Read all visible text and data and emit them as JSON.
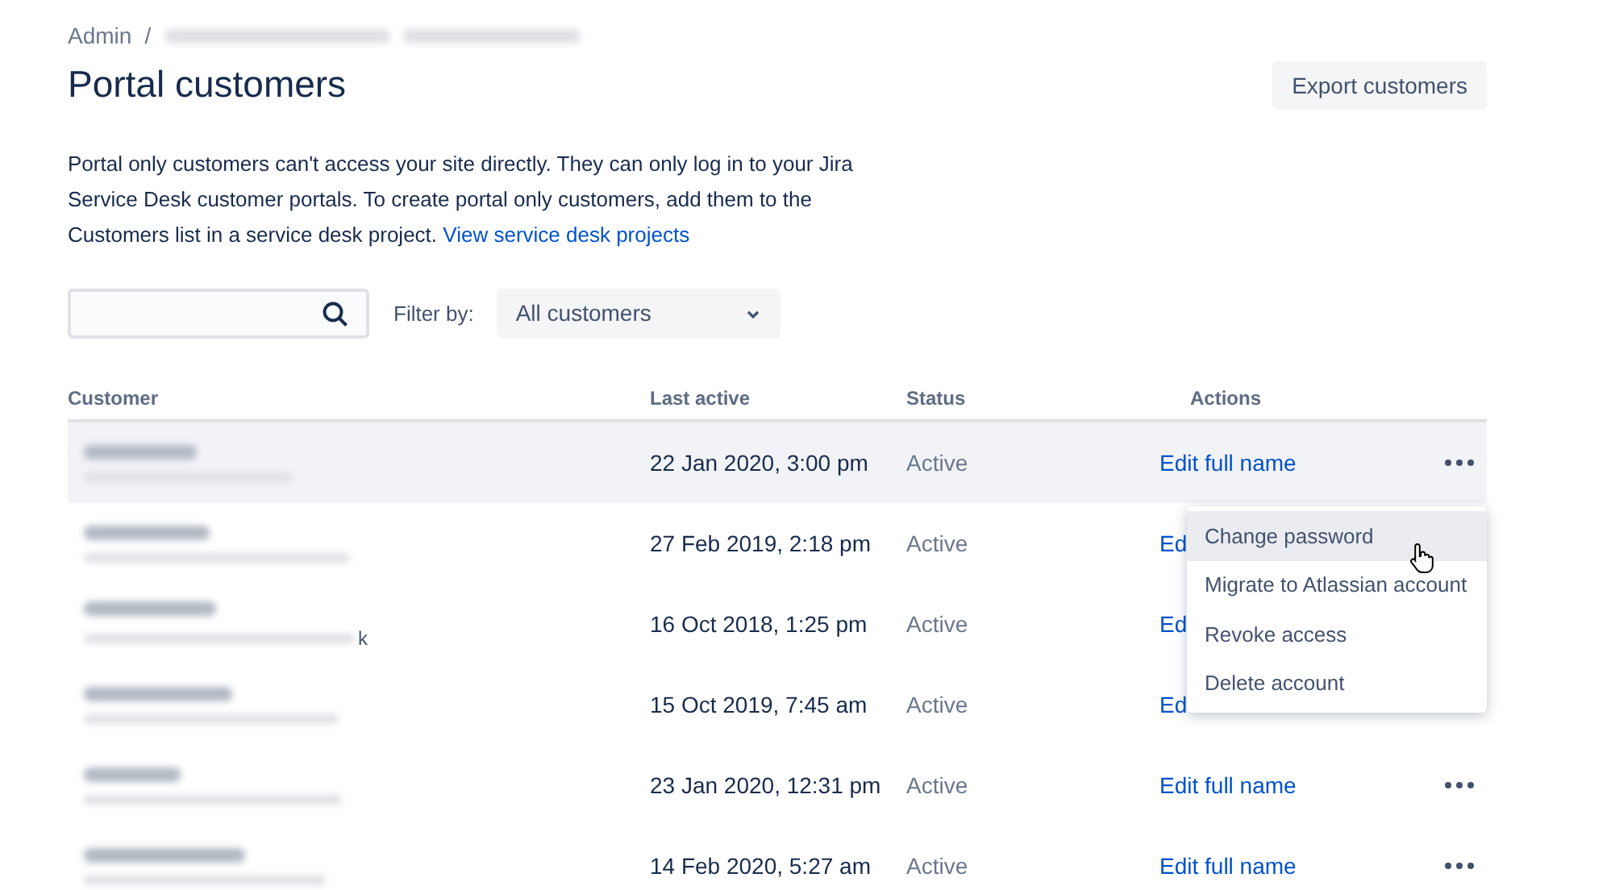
{
  "breadcrumb": {
    "root": "Admin",
    "separator": "/"
  },
  "title": "Portal customers",
  "export_button": "Export customers",
  "description": {
    "text": "Portal only customers can't access your site directly. They can only log in to your Jira Service Desk customer portals. To create portal only customers, add them to the Customers list in a service desk project.",
    "link": "View service desk projects"
  },
  "filter": {
    "label": "Filter by:",
    "value": "All customers"
  },
  "table": {
    "columns": [
      "Customer",
      "Last active",
      "Status",
      "Actions"
    ],
    "rows": [
      {
        "last_active": "22 Jan 2020, 3:00 pm",
        "status": "Active",
        "action": "Edit full name",
        "more": true,
        "selected": true
      },
      {
        "last_active": "27 Feb 2019, 2:18 pm",
        "status": "Active",
        "action": "Ed",
        "selected": false
      },
      {
        "last_active": "16 Oct 2018, 1:25 pm",
        "status": "Active",
        "action": "Ed",
        "selected": false,
        "email_tail": "k"
      },
      {
        "last_active": "15 Oct 2019, 7:45 am",
        "status": "Active",
        "action": "Ed",
        "selected": false
      },
      {
        "last_active": "23 Jan 2020, 12:31 pm",
        "status": "Active",
        "action": "Edit full name",
        "more": true,
        "selected": false
      },
      {
        "last_active": "14 Feb 2020, 5:27 am",
        "status": "Active",
        "action": "Edit full name",
        "more": true,
        "selected": false
      }
    ]
  },
  "menu": {
    "items": [
      {
        "label": "Change password",
        "selected": true
      },
      {
        "label": "Migrate to Atlassian account",
        "selected": false
      },
      {
        "label": "Revoke access",
        "selected": false
      },
      {
        "label": "Delete account",
        "selected": false
      }
    ]
  }
}
